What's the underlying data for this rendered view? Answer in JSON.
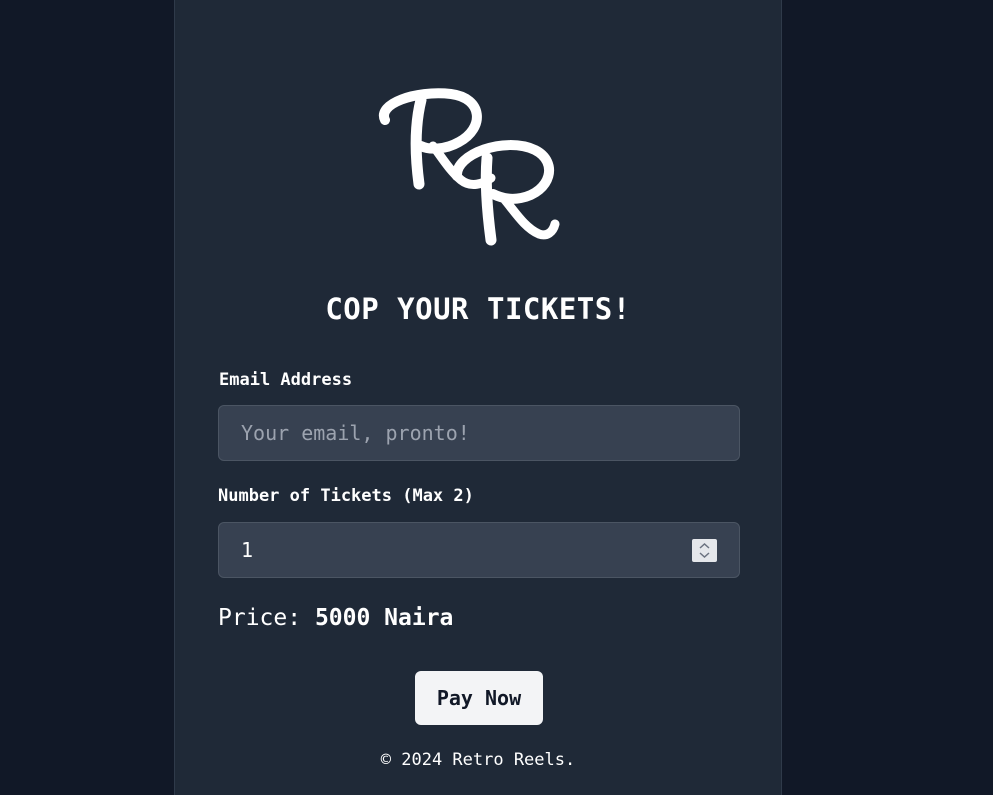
{
  "logo": {
    "text": "RR",
    "icon": "retro-reels-logo"
  },
  "form": {
    "title": "COP YOUR TICKETS!",
    "email_label": "Email Address",
    "email_placeholder": "Your email, pronto!",
    "email_value": "",
    "tickets_label": "Number of Tickets (Max 2)",
    "tickets_value": "1",
    "price_label": "Price:",
    "price_value": "5000 Naira",
    "submit_label": "Pay Now"
  },
  "footer": {
    "text": "© 2024 Retro Reels."
  },
  "colors": {
    "page_background": "#111827",
    "panel_background": "#1f2937",
    "input_background": "#374151",
    "button_background": "#f3f4f6",
    "text": "#ffffff"
  }
}
